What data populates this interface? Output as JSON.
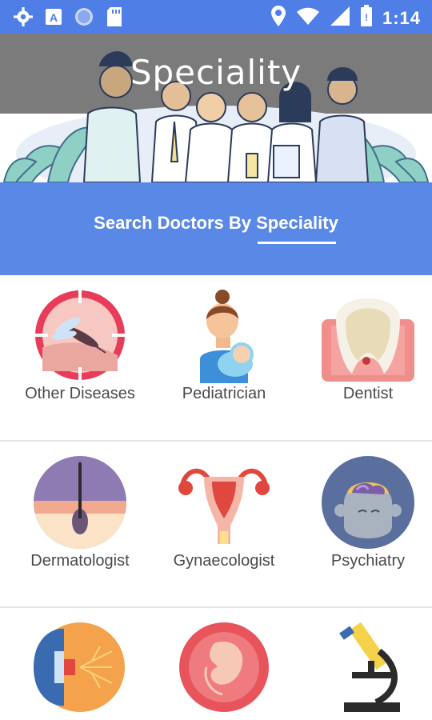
{
  "status_bar": {
    "time": "1:14",
    "icons": [
      "settings-icon",
      "a-icon",
      "circle-icon",
      "sd-card-icon",
      "location-icon",
      "wifi-icon",
      "signal-icon",
      "battery-icon"
    ]
  },
  "header": {
    "title": "Speciality"
  },
  "search_section": {
    "title_prefix": "Search Doctors By ",
    "title_highlight": "Speciality"
  },
  "specialities": [
    {
      "label": "Other Diseases",
      "icon": "mosquito-icon"
    },
    {
      "label": "Pediatrician",
      "icon": "mother-baby-icon"
    },
    {
      "label": "Dentist",
      "icon": "tooth-icon"
    },
    {
      "label": "Dermatologist",
      "icon": "skin-hair-icon"
    },
    {
      "label": "Gynaecologist",
      "icon": "uterus-icon"
    },
    {
      "label": "Psychiatry",
      "icon": "brain-head-icon"
    },
    {
      "label": "",
      "icon": "eye-icon"
    },
    {
      "label": "",
      "icon": "fetus-icon"
    },
    {
      "label": "",
      "icon": "microscope-icon"
    }
  ],
  "colors": {
    "status_bar": "#4f7fe6",
    "search_band": "#5a88e6",
    "banner_overlay": "#7b7b7b"
  }
}
